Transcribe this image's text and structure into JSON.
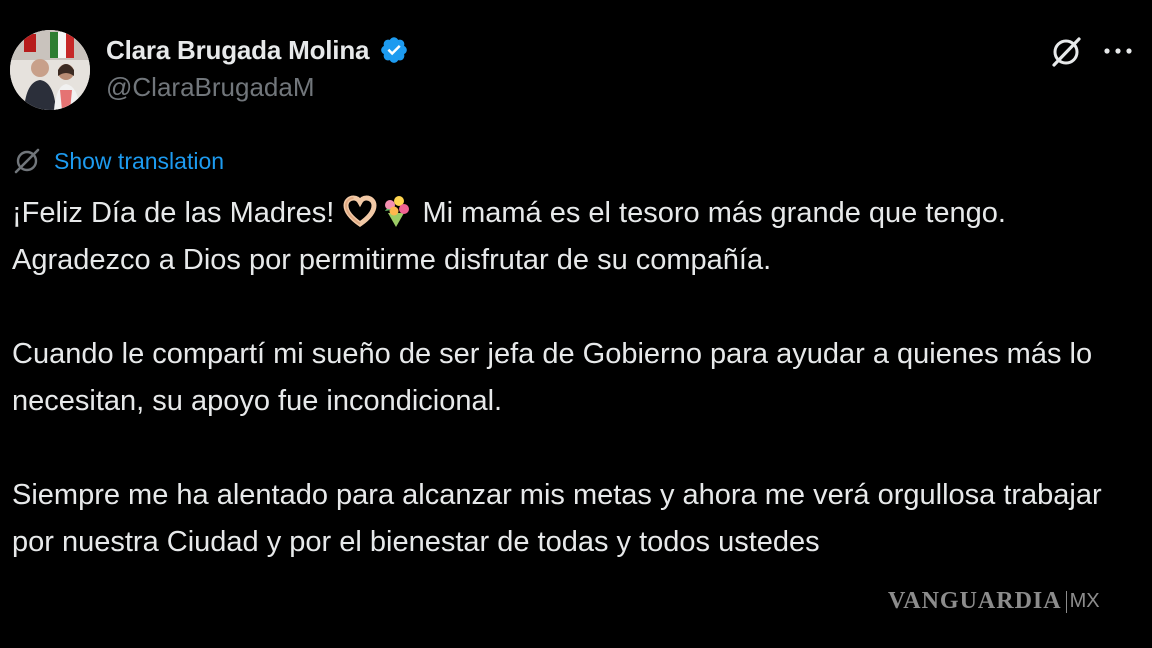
{
  "author": {
    "display_name": "Clara Brugada Molina",
    "handle": "@ClaraBrugadaM",
    "verified": true,
    "verified_badge_icon": "verified-badge-icon",
    "verified_color": "#1d9bf0"
  },
  "header_actions": {
    "grok_icon": "grok-icon",
    "more_icon": "more-options-icon"
  },
  "translation": {
    "label": "Show translation",
    "icon": "translate-icon",
    "color": "#1d9bf0"
  },
  "tweet": {
    "paragraphs": [
      {
        "before_emoji": "¡Feliz Día de las Madres! ",
        "emojis": [
          "heart-hands-emoji",
          "bouquet-emoji"
        ],
        "after_emoji": " Mi mamá es el tesoro más grande que tengo. Agradezco a Dios por permitirme disfrutar de su compañía."
      },
      {
        "text": "Cuando le compartí mi sueño de ser jefa de Gobierno para ayudar a quienes más lo necesitan, su apoyo fue incondicional."
      },
      {
        "text": "Siempre me ha alentado para alcanzar mis metas y ahora me verá orgullosa trabajar por nuestra Ciudad y por el bienestar de todas y todos ustedes"
      }
    ]
  },
  "watermark": {
    "brand": "VANGUARDIA",
    "suffix": "MX"
  },
  "colors": {
    "background": "#000000",
    "text": "#e7e9ea",
    "muted": "#71767b",
    "accent": "#1d9bf0"
  }
}
